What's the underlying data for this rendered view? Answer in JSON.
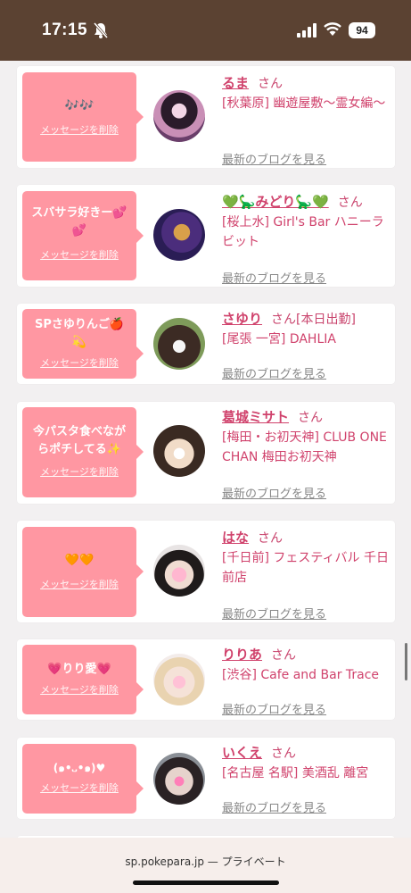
{
  "status": {
    "time": "17:15",
    "battery": "94"
  },
  "browser": {
    "url_text": "sp.pokepara.jp — プライベート"
  },
  "common": {
    "delete_label": "メッセージを削除",
    "blog_label": "最新のブログを見る",
    "san": "さん"
  },
  "cards": [
    {
      "message": "🎶🎶",
      "name": "るま",
      "san": "さん",
      "shop": "[秋葉原] 幽遊屋敷〜霊女編〜"
    },
    {
      "message": "スバサラ好きー💕💕",
      "name": "💚🦕みどり🦕💚",
      "san": "さん",
      "shop": "[桜上水] Girl's Bar ハニーラビット"
    },
    {
      "message": "SPさゆりんご🍎💫",
      "name": "さゆり",
      "san": "さん[本日出勤]",
      "shop": "[尾張 一宮] DAHLIA"
    },
    {
      "message": "今パスタ食べながらポチしてる✨",
      "name": "葛城ミサト",
      "san": "さん",
      "shop": "[梅田・お初天神] CLUB ONE CHAN 梅田お初天神"
    },
    {
      "message": "🧡🧡",
      "name": "はな",
      "san": "さん",
      "shop": "[千日前] フェスティバル 千日前店"
    },
    {
      "message": "💗りり愛💗",
      "name": "りりあ",
      "san": "さん",
      "shop": "[渋谷] Cafe and Bar Trace"
    },
    {
      "message": "(๑•᎑•๑)♥",
      "name": "いくえ",
      "san": "さん",
      "shop": "[名古屋 名駅] 美酒乱 離宮"
    }
  ]
}
